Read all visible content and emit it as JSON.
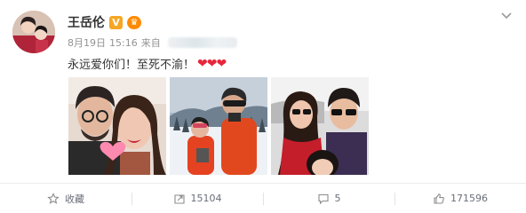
{
  "author": {
    "name": "王岳伦",
    "verified_badge": "V",
    "crown_icon": "crown-icon",
    "avatar_icon": "avatar"
  },
  "meta": {
    "date": "8月19日",
    "time": "15:16",
    "source_prefix": "来自"
  },
  "post": {
    "text": "永远爱你们！至死不渝！",
    "hearts": "❤❤❤",
    "heart_color": "#e8263b"
  },
  "photos": [
    {
      "name": "photo-couple-selfie"
    },
    {
      "name": "photo-ski-family"
    },
    {
      "name": "photo-car-family"
    }
  ],
  "actions": {
    "favorite": {
      "label": "收藏",
      "icon": "star-icon"
    },
    "repost": {
      "label": "15104",
      "icon": "repost-icon"
    },
    "comment": {
      "label": "5",
      "icon": "comment-icon"
    },
    "like": {
      "label": "171596",
      "icon": "thumbs-up-icon"
    }
  },
  "colors": {
    "meta_gray": "#939393",
    "action_gray": "#696e78",
    "vip_orange": "#f6a623"
  }
}
